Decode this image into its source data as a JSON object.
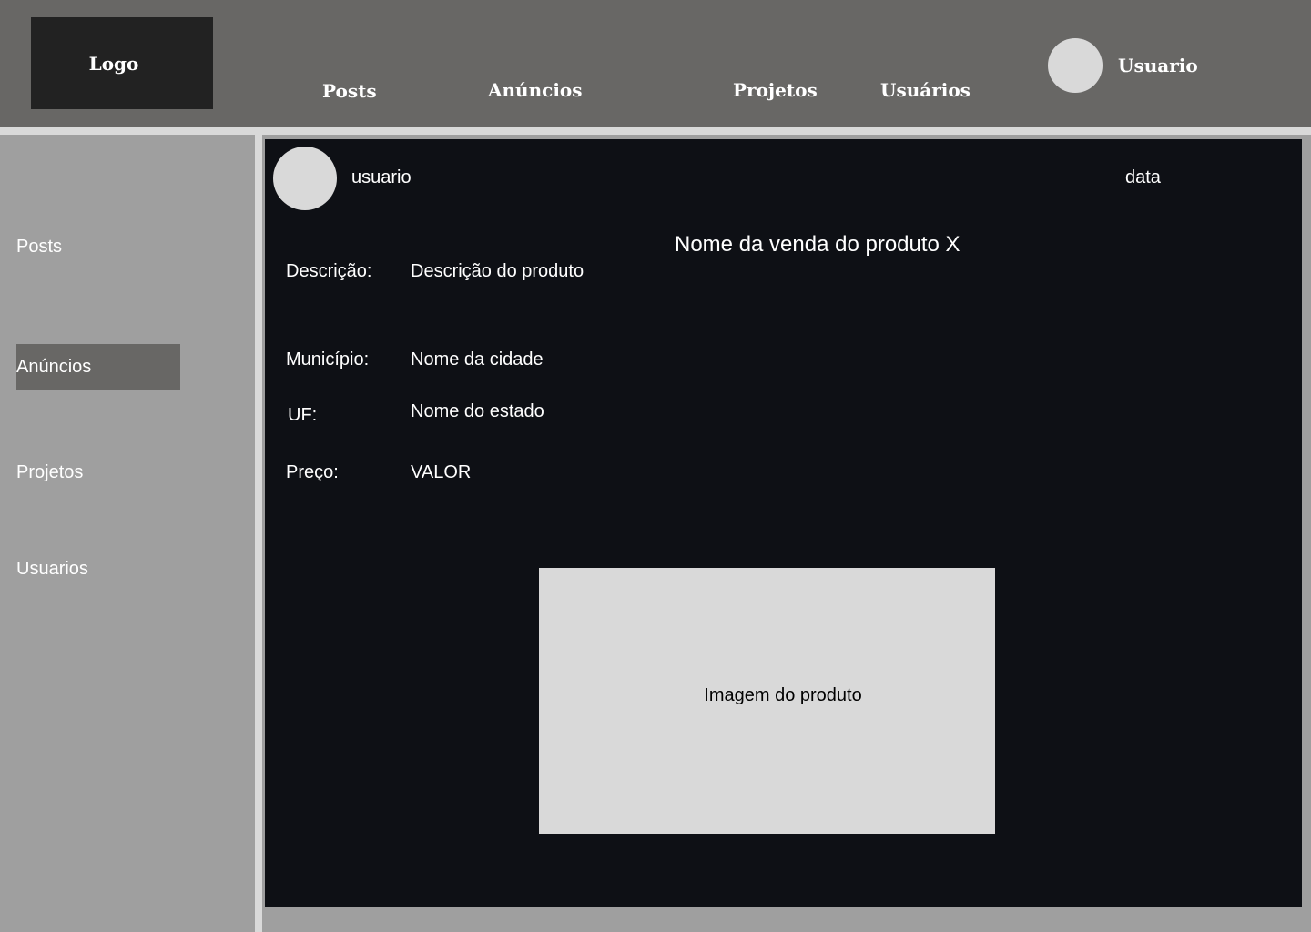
{
  "header": {
    "logo_text": "Logo",
    "nav": [
      "Posts",
      "Anúncios",
      "Projetos",
      "Usuários"
    ],
    "user_name": "Usuario"
  },
  "sidebar": {
    "items": [
      {
        "label": "Posts",
        "active": false
      },
      {
        "label": "Anúncios",
        "active": true
      },
      {
        "label": "Projetos",
        "active": false
      },
      {
        "label": "Usuarios",
        "active": false
      }
    ]
  },
  "post": {
    "user": "usuario",
    "date": "data",
    "title": "Nome da venda do produto X",
    "fields": [
      {
        "label": "Descrição:",
        "value": "Descrição do produto"
      },
      {
        "label": "Município:",
        "value": "Nome da cidade"
      },
      {
        "label": "UF:",
        "value": "Nome do estado"
      },
      {
        "label": "Preço:",
        "value": "VALOR"
      }
    ],
    "image_placeholder": "Imagem do produto"
  },
  "colors": {
    "header_bg": "#686765",
    "logo_bg": "#222222",
    "sidebar_bg": "#9f9f9f",
    "active_item_bg": "#686765",
    "card_bg": "#0e1015",
    "placeholder_bg": "#d9d9d9"
  }
}
